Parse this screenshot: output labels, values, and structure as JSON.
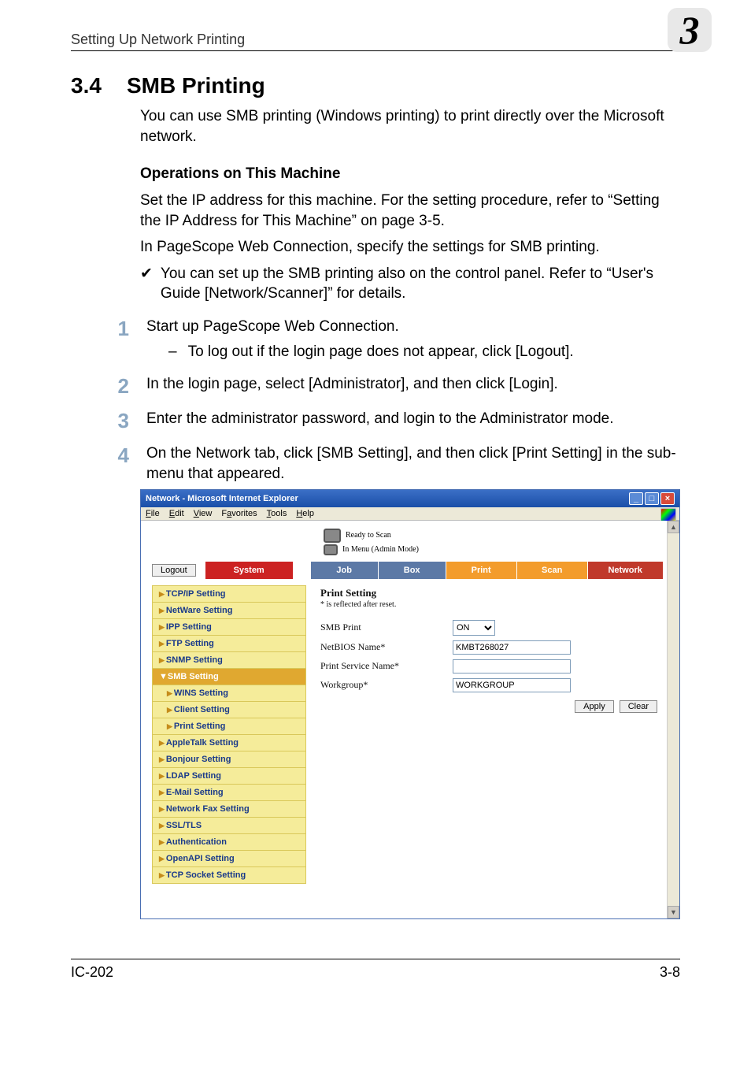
{
  "header": {
    "section": "Setting Up Network Printing",
    "chapter": "3"
  },
  "section": {
    "number": "3.4",
    "title": "SMB Printing"
  },
  "intro": "You can use SMB printing (Windows printing) to print directly over the Microsoft network.",
  "sub_heading": "Operations on This Machine",
  "p1": "Set the IP address for this machine. For the setting procedure, refer to “Setting the IP Address for This Machine” on page 3-5.",
  "p2": "In PageScope Web Connection, specify the settings for SMB printing.",
  "check1": "You can set up the SMB printing also on the control panel. Refer to “User's Guide [Network/Scanner]” for details.",
  "checkmark": "✔",
  "dash": "–",
  "steps": [
    {
      "n": "1",
      "t": "Start up PageScope Web Connection.",
      "sub": "To log out if the login page does not appear, click [Logout]."
    },
    {
      "n": "2",
      "t": "In the login page, select [Administrator], and then click [Login]."
    },
    {
      "n": "3",
      "t": "Enter the administrator password, and login to the Administrator mode."
    },
    {
      "n": "4",
      "t": "On the Network tab, click [SMB Setting], and then click [Print Setting] in the sub-menu that appeared."
    }
  ],
  "ie": {
    "title": "Network - Microsoft Internet Explorer",
    "btn_min": "_",
    "btn_max": "□",
    "btn_close": "×",
    "menu": {
      "file": "File",
      "edit": "Edit",
      "view": "View",
      "favorites": "Favorites",
      "tools": "Tools",
      "help": "Help"
    },
    "status1": "Ready to Scan",
    "status2": "In Menu (Admin Mode)",
    "logout": "Logout",
    "tabs": {
      "system": "System",
      "job": "Job",
      "box": "Box",
      "print": "Print",
      "scan": "Scan",
      "network": "Network"
    },
    "side": [
      "TCP/IP Setting",
      "NetWare Setting",
      "IPP Setting",
      "FTP Setting",
      "SNMP Setting",
      "SMB Setting",
      "WINS Setting",
      "Client Setting",
      "Print Setting",
      "AppleTalk Setting",
      "Bonjour Setting",
      "LDAP Setting",
      "E-Mail Setting",
      "Network Fax Setting",
      "SSL/TLS",
      "Authentication",
      "OpenAPI Setting",
      "TCP Socket Setting"
    ],
    "panel": {
      "title": "Print Setting",
      "note": "* is reflected after reset.",
      "rows": {
        "smb_print_label": "SMB Print",
        "smb_print_value": "ON",
        "netbios_label": "NetBIOS Name*",
        "netbios_value": "KMBT268027",
        "service_label": "Print Service Name*",
        "service_value": "",
        "workgroup_label": "Workgroup*",
        "workgroup_value": "WORKGROUP"
      },
      "apply": "Apply",
      "clear": "Clear"
    },
    "scroll_up": "▲",
    "scroll_down": "▼"
  },
  "footer": {
    "left": "IC-202",
    "right": "3-8"
  }
}
